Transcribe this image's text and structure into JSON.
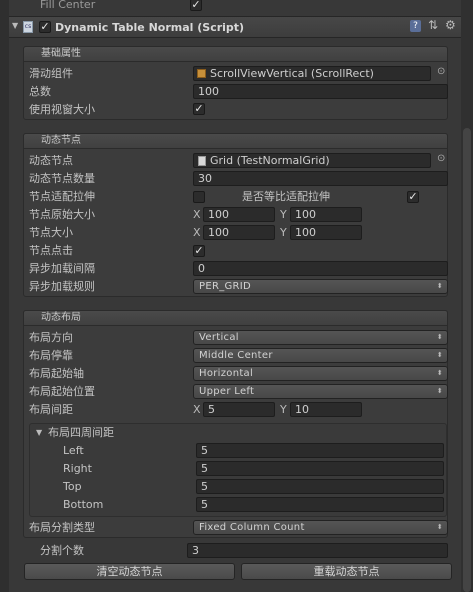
{
  "top": {
    "fill_center_label": "Fill Center",
    "fill_center_checked": true
  },
  "component": {
    "title": "Dynamic Table Normal (Script)",
    "enabled": true,
    "icons": [
      "help-icon",
      "preset-icon",
      "settings-gear-icon"
    ]
  },
  "basic": {
    "header": "基础属性",
    "scroll_label": "滑动组件",
    "scroll_value": "ScrollViewVertical (ScrollRect)",
    "total_label": "总数",
    "total_value": "100",
    "viewport_label": "使用视窗大小",
    "viewport_checked": true
  },
  "node": {
    "header": "动态节点",
    "node_label": "动态节点",
    "node_value": "Grid (TestNormalGrid)",
    "count_label": "动态节点数量",
    "count_value": "30",
    "stretch_label": "节点适配拉伸",
    "stretch_checked": false,
    "equal_label": "是否等比适配拉伸",
    "equal_checked": true,
    "orig_size_label": "节点原始大小",
    "orig_x": "100",
    "orig_y": "100",
    "size_label": "节点大小",
    "size_x": "100",
    "size_y": "100",
    "click_label": "节点点击",
    "click_checked": true,
    "async_interval_label": "异步加载间隔",
    "async_interval_value": "0",
    "async_rule_label": "异步加载规则",
    "async_rule_value": "PER_GRID"
  },
  "layout": {
    "header": "动态布局",
    "direction_label": "布局方向",
    "direction_value": "Vertical",
    "dock_label": "布局停靠",
    "dock_value": "Middle Center",
    "axis_label": "布局起始轴",
    "axis_value": "Horizontal",
    "start_label": "布局起始位置",
    "start_value": "Upper Left",
    "spacing_label": "布局间距",
    "spacing_x": "5",
    "spacing_y": "10",
    "padding_label": "布局四周间距",
    "left_label": "Left",
    "left_value": "5",
    "right_label": "Right",
    "right_value": "5",
    "top_label": "Top",
    "top_value": "5",
    "bottom_label": "Bottom",
    "bottom_value": "5",
    "split_type_label": "布局分割类型",
    "split_type_value": "Fixed Column Count"
  },
  "split": {
    "count_label": "分割个数",
    "count_value": "3"
  },
  "buttons": {
    "clear_label": "清空动态节点",
    "reload_label": "重载动态节点"
  },
  "axis_letters": {
    "x": "X",
    "y": "Y"
  }
}
